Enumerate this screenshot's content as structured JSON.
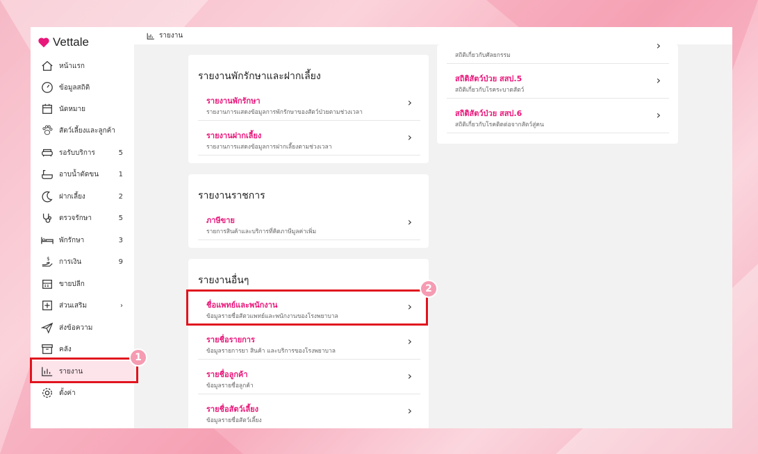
{
  "app": {
    "name": "Vettale"
  },
  "breadcrumb": {
    "label": "รายงาน"
  },
  "sidebar": {
    "items": [
      {
        "label": "หน้าแรก",
        "count": ""
      },
      {
        "label": "ข้อมูลสถิติ",
        "count": ""
      },
      {
        "label": "นัดหมาย",
        "count": ""
      },
      {
        "label": "สัตว์เลี้ยงและลูกค้า",
        "count": ""
      },
      {
        "label": "รอรับบริการ",
        "count": "5"
      },
      {
        "label": "อาบน้ำตัดขน",
        "count": "1"
      },
      {
        "label": "ฝากเลี้ยง",
        "count": "2"
      },
      {
        "label": "ตรวจรักษา",
        "count": "5"
      },
      {
        "label": "พักรักษา",
        "count": "3"
      },
      {
        "label": "การเงิน",
        "count": "9"
      },
      {
        "label": "ขายปลีก",
        "count": ""
      },
      {
        "label": "ส่วนเสริม",
        "count": "›"
      },
      {
        "label": "ส่งข้อความ",
        "count": ""
      },
      {
        "label": "คลัง",
        "count": ""
      },
      {
        "label": "รายงาน",
        "count": ""
      },
      {
        "label": "ตั้งค่า",
        "count": ""
      }
    ]
  },
  "cards": {
    "boarding": {
      "title": "รายงานพักรักษาและฝากเลี้ยง",
      "rows": [
        {
          "title": "รายงานพักรักษา",
          "sub": "รายงานการแสดงข้อมูลการพักรักษาของสัตว์ป่วยตามช่วงเวลา"
        },
        {
          "title": "รายงานฝากเลี้ยง",
          "sub": "รายงานการแสดงข้อมูลการฝากเลี้ยงตามช่วงเวลา"
        }
      ]
    },
    "government": {
      "title": "รายงานราชการ",
      "rows": [
        {
          "title": "ภาษีขาย",
          "sub": "รายการสินค้าและบริการที่คิดภาษีมูลค่าเพิ่ม"
        }
      ]
    },
    "other": {
      "title": "รายงานอื่นๆ",
      "rows": [
        {
          "title": "ชื่อแพทย์และพนักงาน",
          "sub": "ข้อมูลรายชื่อสัตวแพทย์และพนักงานของโรงพยาบาล"
        },
        {
          "title": "รายชื่อรายการ",
          "sub": "ข้อมูลรายการยา สินค้า และบริการของโรงพยาบาล"
        },
        {
          "title": "รายชื่อลูกค้า",
          "sub": "ข้อมูลรายชื่อลูกค้า"
        },
        {
          "title": "รายชื่อสัตว์เลี้ยง",
          "sub": "ข้อมูลรายชื่อสัตว์เลี้ยง"
        }
      ]
    },
    "stats": {
      "top_sub": "สถิติเกี่ยวกับศัลยกรรม",
      "rows": [
        {
          "title": "สถิติสัตว์ป่วย สสป.5",
          "sub": "สถิติเกี่ยวกับโรคระบาดสัตว์"
        },
        {
          "title": "สถิติสัตว์ป่วย สสป.6",
          "sub": "สถิติเกี่ยวกับโรคติดต่อจากสัตว์สู่คน"
        }
      ]
    }
  },
  "markers": {
    "one": "1",
    "two": "2"
  },
  "colors": {
    "accent": "#e8177a",
    "highlight": "#e1131e",
    "badge": "#f59bb2"
  }
}
